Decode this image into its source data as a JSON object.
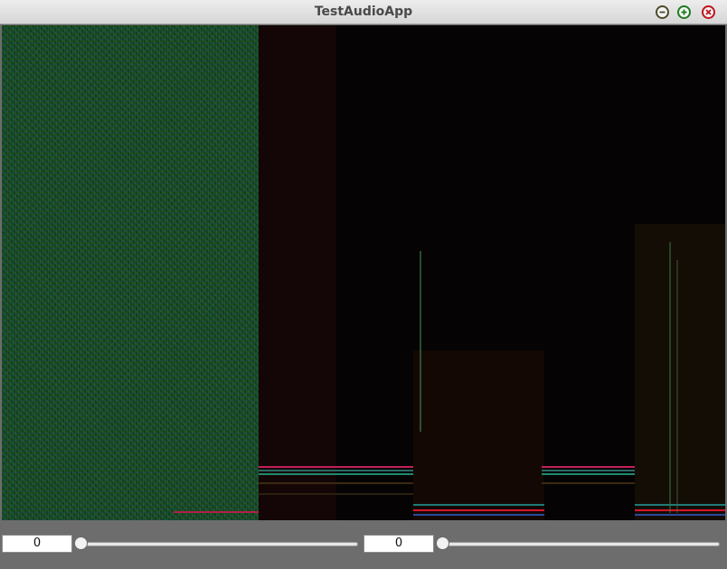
{
  "window": {
    "title": "TestAudioApp",
    "buttons": [
      {
        "icon": "minimize-icon",
        "color": "#4e4a2a"
      },
      {
        "icon": "maximize-icon",
        "color": "#1f7a1f"
      },
      {
        "icon": "close-icon",
        "color": "#c0141a"
      }
    ]
  },
  "spectrogram": {
    "background_color": "#050303",
    "noise_color": "#1c4a1e"
  },
  "controls": {
    "left": {
      "value": "0",
      "slider_value": 0
    },
    "right": {
      "value": "0",
      "slider_value": 0
    }
  }
}
